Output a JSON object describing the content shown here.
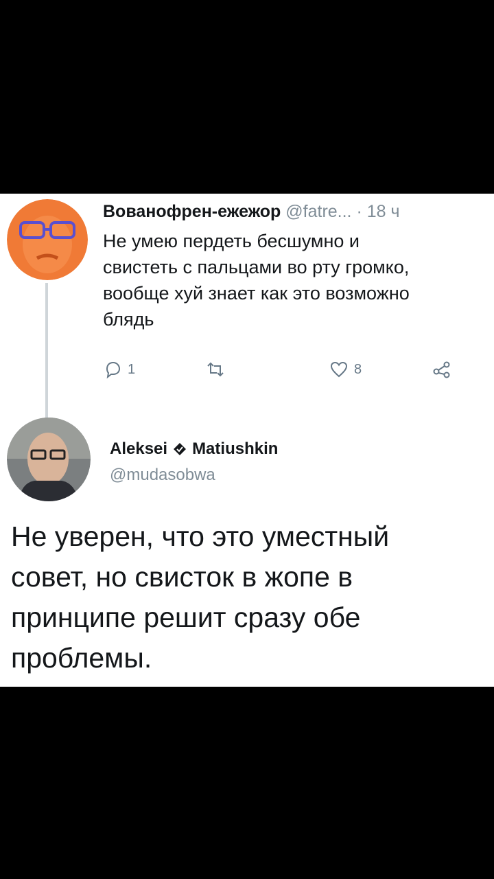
{
  "tweet1": {
    "display_name": "Вованофрен-ежежор",
    "handle": "@fatre...",
    "separator": "·",
    "time": "18 ч",
    "text": "Не умею пердеть бесшумно и\nсвистеть с пальцами во рту громко,\nвообще хуй знает как это возможно\nблядь",
    "actions": {
      "reply_count": "1",
      "retweet_count": "",
      "like_count": "8"
    },
    "icons": [
      "reply-icon",
      "retweet-icon",
      "like-icon",
      "share-icon"
    ]
  },
  "tweet2": {
    "first_name": "Aleksei",
    "last_name": "Matiushkin",
    "handle": "@mudasobwa",
    "text": "Не уверен, что это уместный\nсовет, но свисток в жопе в\nпринципе решит сразу обе\nпроблемы.",
    "icons": [
      "verified-badge-icon"
    ]
  },
  "colors": {
    "background": "#000000",
    "card": "#ffffff",
    "text": "#14171a",
    "secondary": "#7f8c96",
    "avatar1_orange": "#f07a36"
  }
}
